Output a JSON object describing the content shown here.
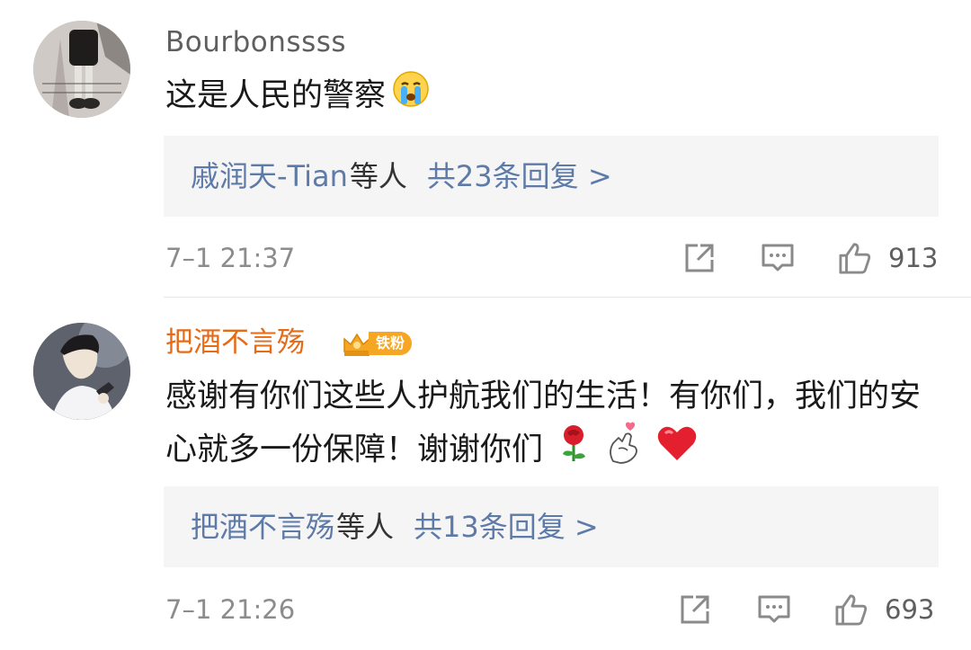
{
  "comments": [
    {
      "username": "Bourbonssss",
      "text": "这是人民的警察",
      "emojis": [
        "crying-face"
      ],
      "replies": {
        "names": "戚润天-Tian",
        "etc": "等人",
        "count": "共23条回复 >"
      },
      "timestamp": "7–1 21:37",
      "likes": "913"
    },
    {
      "username": "把酒不言殇",
      "badge": "铁粉",
      "text": "感谢有你们这些人护航我们的生活！有你们，我们的安心就多一份保障！谢谢你们",
      "emojis": [
        "rose",
        "finger-heart",
        "red-heart"
      ],
      "replies": {
        "names": "把酒不言殇",
        "etc": "等人",
        "count": "共13条回复 >"
      },
      "timestamp": "7–1 21:26",
      "likes": "693"
    }
  ]
}
